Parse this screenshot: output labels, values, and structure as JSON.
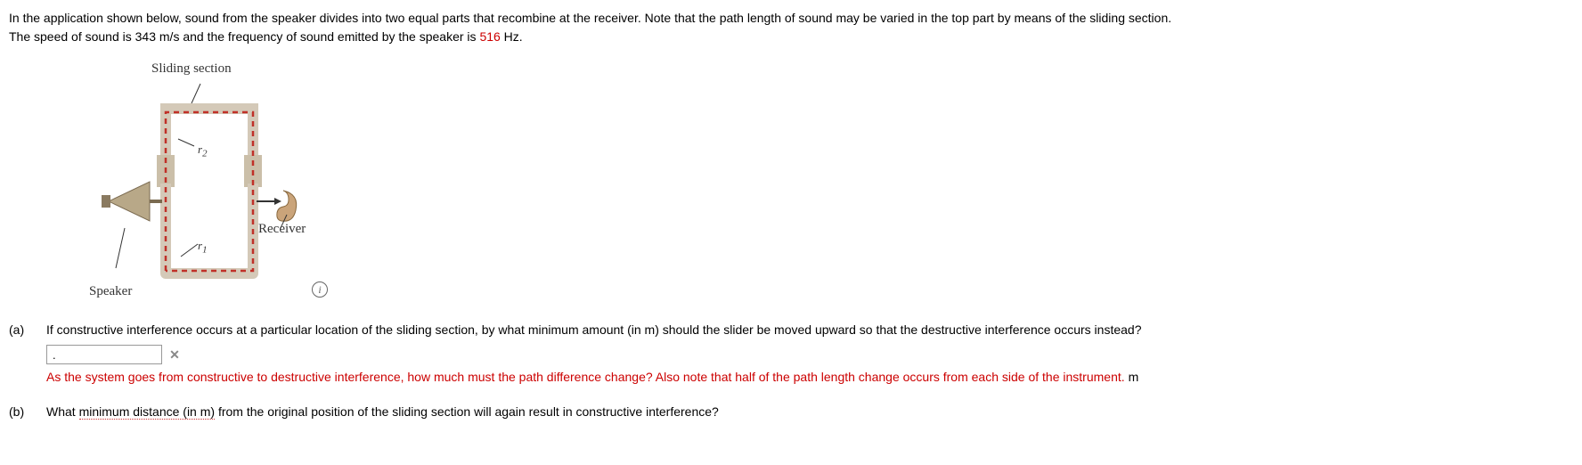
{
  "intro": {
    "line1a": "In the application shown below, sound from the speaker divides into two equal parts that recombine at the receiver. Note that the path length of sound may be varied in the top part by means of the sliding section.",
    "line2a": "The speed of sound is 343 m/s and the frequency of sound emitted by the speaker is ",
    "freq": "516",
    "line2b": " Hz."
  },
  "figure": {
    "sliding_label": "Sliding section",
    "speaker_label": "Speaker",
    "receiver_label": "Receiver",
    "r1": "r",
    "r1_sub": "1",
    "r2": "r",
    "r2_sub": "2",
    "info": "i"
  },
  "parts": {
    "a": {
      "label": "(a)",
      "question": "If constructive interference occurs at a particular location of the sliding section, by what minimum amount (in m) should the slider be moved upward so that the destructive interference occurs instead?",
      "input_value": ".",
      "feedback": "As the system goes from constructive to destructive interference, how much must the path difference change? Also note that half of the path length change occurs from each side of the instrument.",
      "unit": "m"
    },
    "b": {
      "label": "(b)",
      "question_lead": "What ",
      "question_dotted": "minimum distance (in m)",
      "question_tail": " from the original position of the sliding section will again result in constructive interference?"
    }
  }
}
